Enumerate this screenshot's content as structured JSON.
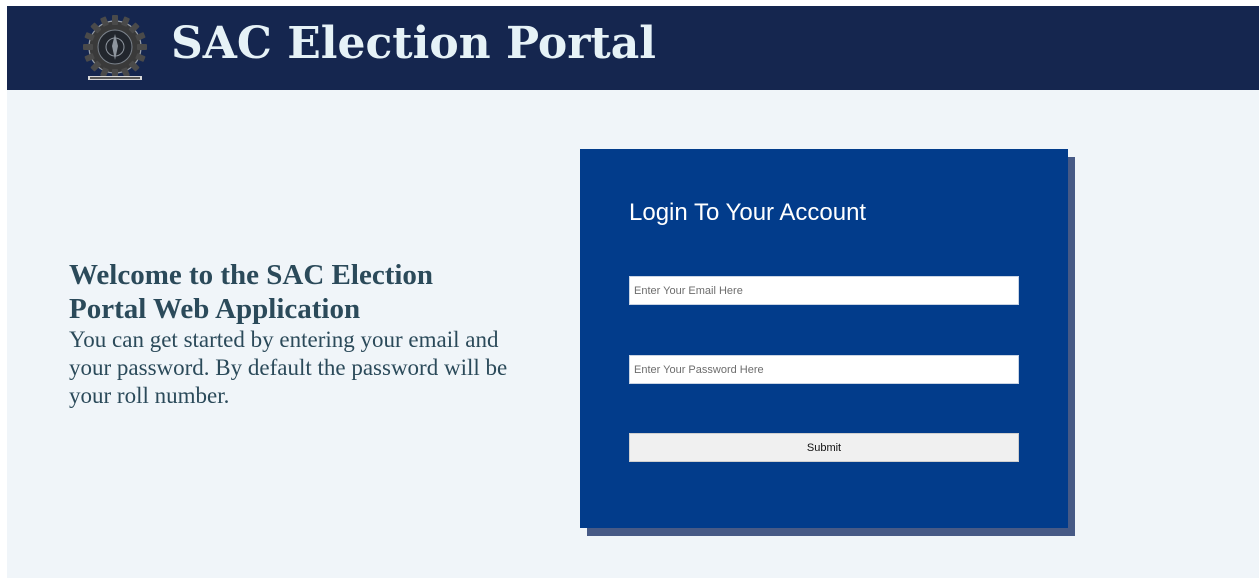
{
  "header": {
    "title": "SAC Election Portal",
    "logo_icon": "gear-emblem-icon"
  },
  "welcome": {
    "heading": "Welcome to the SAC Election Portal Web Application",
    "text": "You can get started by entering your email and your password. By default the password will be your roll number."
  },
  "login": {
    "title": "Login To Your Account",
    "email_placeholder": "Enter Your Email Here",
    "password_placeholder": "Enter Your Password Here",
    "submit_label": "Submit"
  },
  "colors": {
    "header_bg": "#15264f",
    "page_bg": "#f0f5f9",
    "card_bg": "#023c8b",
    "card_shadow": "#475a86",
    "title_text": "#e6f2f7",
    "welcome_text": "#2b4a5a"
  }
}
